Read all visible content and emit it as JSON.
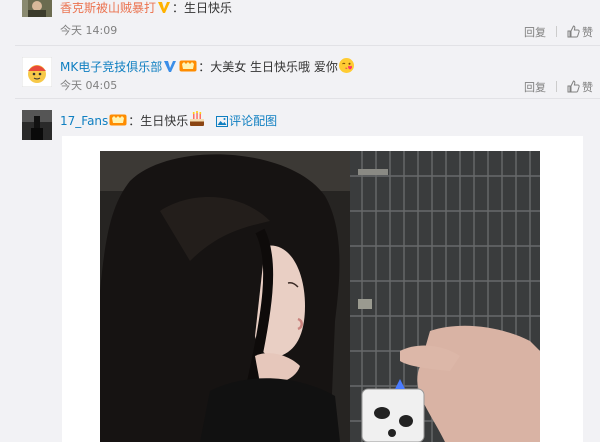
{
  "comments": [
    {
      "user": "香克斯被山贼暴打",
      "text": "：生日快乐",
      "time": "今天 14:09",
      "reply": "回复",
      "like": "赞"
    },
    {
      "user": "MK电子竞技俱乐部",
      "text": "：大美女 生日快乐哦 爱你",
      "time": "今天 04:05",
      "reply": "回复",
      "like": "赞"
    },
    {
      "user": "17_Fans",
      "text": "：生日快乐",
      "image_link": "评论配图"
    }
  ],
  "colors": {
    "username": "#eb7350",
    "link": "#0f7fc1",
    "meta": "#808080",
    "verified": "#ffb200"
  },
  "icons": [
    "verified-v-icon",
    "vip-badge-icon",
    "kiss-emoji-icon",
    "cake-emoji-icon",
    "image-icon",
    "thumb-up-icon"
  ]
}
